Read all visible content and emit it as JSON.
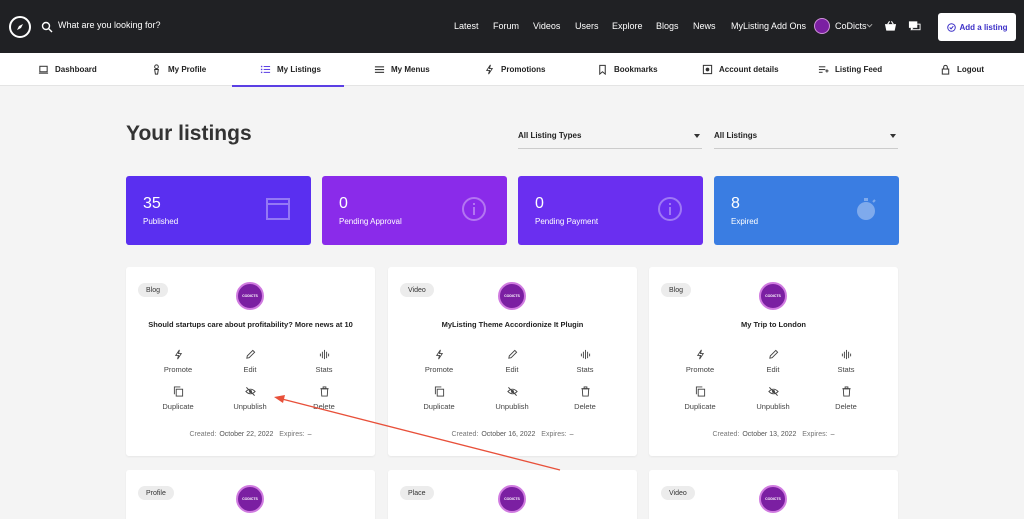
{
  "header": {
    "search_placeholder": "What are you looking for?",
    "nav": [
      "Latest",
      "Forum",
      "Videos",
      "Users",
      "Explore",
      "Blogs",
      "News",
      "MyListing Add Ons"
    ],
    "user_name": "CoDicts",
    "add_listing_label": "Add a listing"
  },
  "subnav": {
    "items": [
      "Dashboard",
      "My Profile",
      "My Listings",
      "My Menus",
      "Promotions",
      "Bookmarks",
      "Account details",
      "Listing Feed",
      "Logout"
    ],
    "active": "My Listings"
  },
  "page": {
    "title": "Your listings",
    "filter_types": "All Listing Types",
    "filter_status": "All Listings"
  },
  "stats": [
    {
      "count": "35",
      "label": "Published",
      "color": "#5a2ff0"
    },
    {
      "count": "0",
      "label": "Pending Approval",
      "color": "#8a2bea"
    },
    {
      "count": "0",
      "label": "Pending Payment",
      "color": "#6a2ff0"
    },
    {
      "count": "8",
      "label": "Expired",
      "color": "#3a7de2"
    }
  ],
  "actions": {
    "promote": "Promote",
    "edit": "Edit",
    "stats": "Stats",
    "duplicate": "Duplicate",
    "unpublish": "Unpublish",
    "delete": "Delete"
  },
  "meta_labels": {
    "created": "Created:",
    "expires": "Expires:"
  },
  "avatar_text": "CODICTS",
  "listings": [
    {
      "type": "Blog",
      "title": "Should startups care about profitability? More news at 10",
      "created": "October 22, 2022",
      "expires": "–"
    },
    {
      "type": "Video",
      "title": "MyListing Theme Accordionize It Plugin",
      "created": "October 16, 2022",
      "expires": "–"
    },
    {
      "type": "Blog",
      "title": "My Trip to London",
      "created": "October 13, 2022",
      "expires": "–"
    },
    {
      "type": "Profile"
    },
    {
      "type": "Place"
    },
    {
      "type": "Video"
    }
  ],
  "colors": {
    "accent": "#5b3fe4",
    "annotation_arrow": "#e8503a"
  }
}
